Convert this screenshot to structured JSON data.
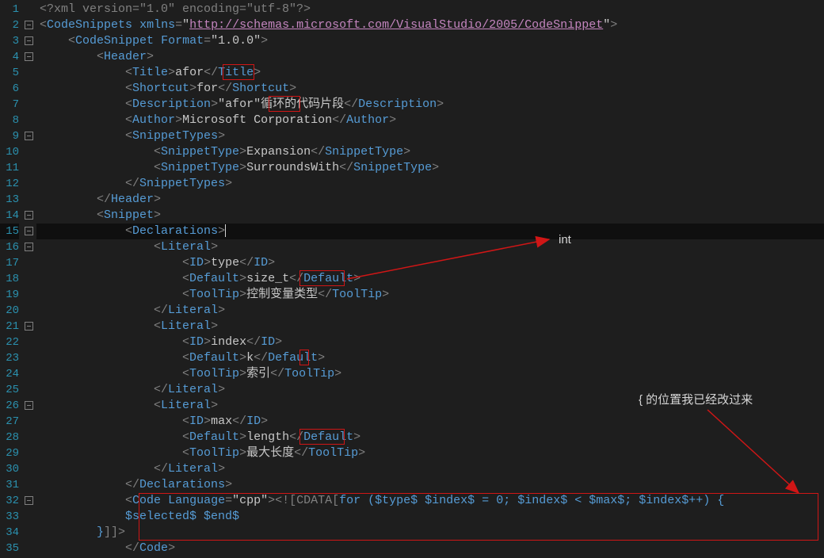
{
  "lineCount": 35,
  "foldLines": [
    2,
    3,
    4,
    9,
    14,
    15,
    16,
    21,
    26,
    32
  ],
  "currentLine": 15,
  "tokens": {
    "xmlDecl": "<?xml version=\"1.0\" encoding=\"utf-8\"?>",
    "ns": "http://schemas.microsoft.com/VisualStudio/2005/CodeSnippet",
    "format": "1.0.0",
    "title": "afor",
    "shortcut": "for",
    "descPre": "\"",
    "descKey": "afor",
    "descPost": "\"循环的代码片段",
    "author": "Microsoft Corporation",
    "stExpansion": "Expansion",
    "stSurrounds": "SurroundsWith",
    "id1": "type",
    "def1": "size_t",
    "tip1": "控制变量类型",
    "id2": "index",
    "def2": "k",
    "tip2": "索引",
    "id3": "max",
    "def3": "length",
    "tip3": "最大长度",
    "lang": "cpp",
    "cdataOpen": "<![CDATA[",
    "codeLine1": "for ($type$ $index$ = 0; $index$ < $max$; $index$++) {",
    "codeLine2": "$selected$ $end$",
    "codeLine3": "}",
    "cdataClose": "]]>"
  },
  "annotations": {
    "int": "int",
    "brace": "{ 的位置我已经改过来"
  }
}
